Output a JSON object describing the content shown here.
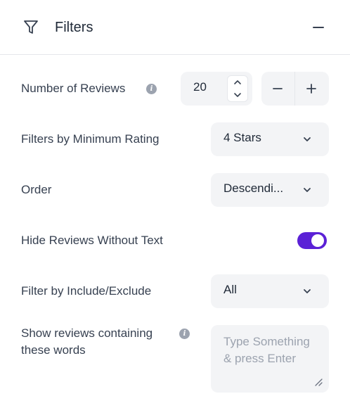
{
  "header": {
    "title": "Filters",
    "filter_icon": "funnel-icon",
    "collapse_icon": "minus-icon"
  },
  "reviews_count": {
    "label": "Number of Reviews",
    "info_icon": "info-icon",
    "value": "20"
  },
  "min_rating": {
    "label": "Filters by Minimum Rating",
    "selected": "4 Stars"
  },
  "order": {
    "label": "Order",
    "selected": "Descendi..."
  },
  "hide_without_text": {
    "label": "Hide Reviews Without Text",
    "enabled": true,
    "accent_color": "#5b21d6"
  },
  "include_exclude": {
    "label": "Filter by Include/Exclude",
    "selected": "All"
  },
  "contains_words": {
    "label_line1": "Show reviews containing",
    "label_line2": "these words",
    "info_icon": "info-icon",
    "placeholder": "Type Something & press Enter"
  }
}
